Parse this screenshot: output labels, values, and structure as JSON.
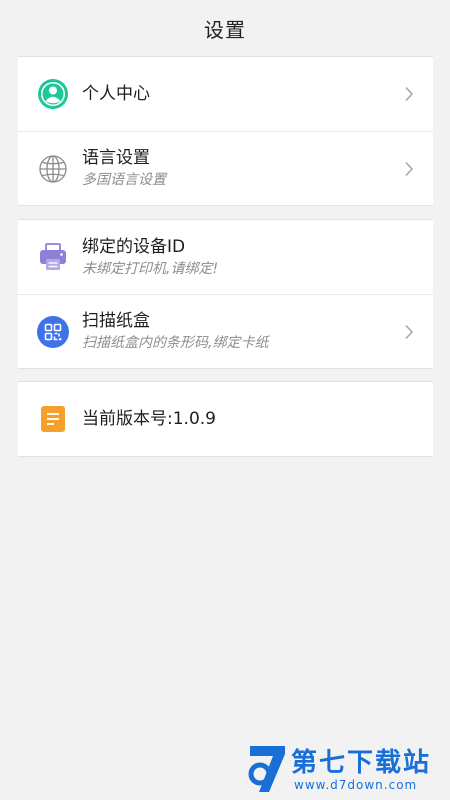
{
  "header": {
    "title": "设置"
  },
  "sections": {
    "profile": {
      "label": "个人中心"
    },
    "language": {
      "label": "语言设置",
      "sub": "多国语言设置"
    },
    "device": {
      "label": "绑定的设备ID",
      "sub": "未绑定打印机,请绑定!"
    },
    "scan": {
      "label": "扫描纸盒",
      "sub": "扫描纸盒内的条形码,绑定卡纸"
    },
    "version": {
      "label": "当前版本号:1.0.9"
    }
  },
  "icons": {
    "profile": "person-circle-icon",
    "language": "globe-icon",
    "device": "printer-icon",
    "scan": "qr-scan-icon",
    "version": "document-icon",
    "chevron": "chevron-right-icon"
  },
  "colors": {
    "profile_icon": "#1ec79a",
    "printer_icon": "#8f7fd9",
    "scan_icon": "#3d72e8",
    "version_icon": "#f5a02a"
  },
  "watermark": {
    "name": "第七下载站",
    "url": "www.d7down.com"
  }
}
